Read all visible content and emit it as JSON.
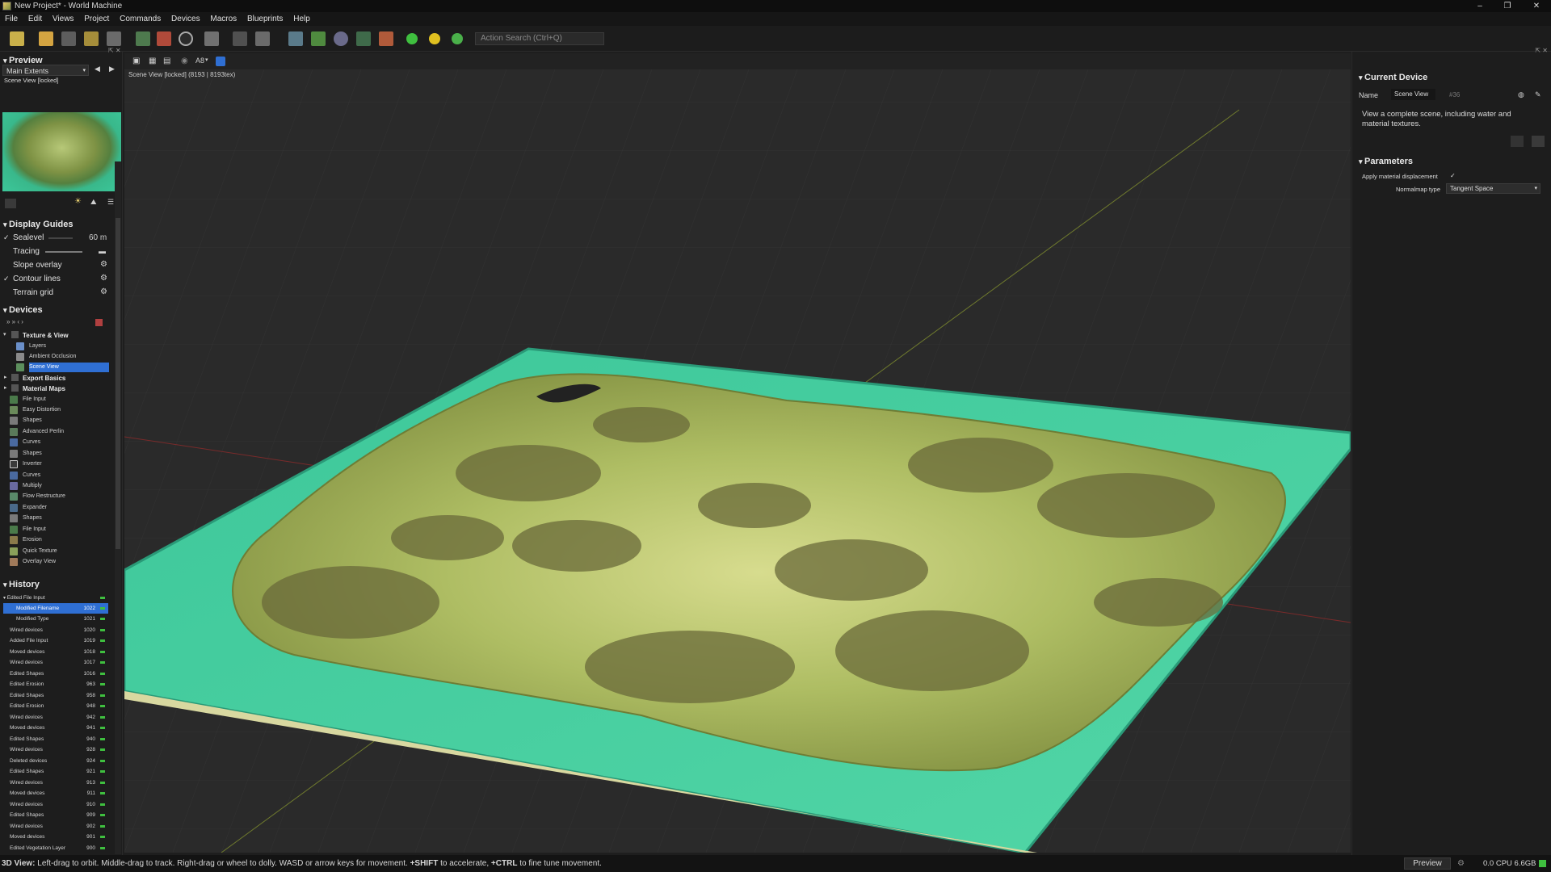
{
  "window": {
    "title": "New Project* - World Machine",
    "minimize": "–",
    "restore": "❐",
    "close": "✕"
  },
  "menu": [
    "File",
    "Edit",
    "Views",
    "Project",
    "Commands",
    "Devices",
    "Macros",
    "Blueprints",
    "Help"
  ],
  "toolbar": {
    "search_placeholder": "Action Search (Ctrl+Q)"
  },
  "preview": {
    "heading": "Preview",
    "extents": "Main Extents",
    "locked_label": "Scene View [locked]"
  },
  "guides": {
    "heading": "Display Guides",
    "items": [
      {
        "label": "Sealevel",
        "checked": "✓",
        "value": "60 m"
      },
      {
        "label": "Tracing",
        "checked": "",
        "value": ""
      },
      {
        "label": "Slope overlay",
        "checked": "",
        "value": ""
      },
      {
        "label": "Contour lines",
        "checked": "✓",
        "value": ""
      },
      {
        "label": "Terrain grid",
        "checked": "",
        "value": ""
      }
    ]
  },
  "devices": {
    "heading": "Devices",
    "groups": {
      "texture_view": "Texture & View",
      "export_basics": "Export Basics",
      "material_maps": "Material Maps"
    },
    "texture_items": [
      "Layers",
      "Ambient Occlusion",
      "Scene View"
    ],
    "items": [
      "File Input",
      "Easy Distortion",
      "Shapes",
      "Advanced Perlin",
      "Curves",
      "Shapes",
      "Inverter",
      "Curves",
      "Multiply",
      "Flow Restructure",
      "Expander",
      "Shapes",
      "File Input",
      "Erosion",
      "Quick Texture",
      "Overlay View"
    ]
  },
  "history": {
    "heading": "History",
    "items": [
      {
        "label": "Edited File Input",
        "n": ""
      },
      {
        "label": "Modified Filename",
        "n": "1022"
      },
      {
        "label": "Modified Type",
        "n": "1021"
      },
      {
        "label": "Wired devices",
        "n": "1020"
      },
      {
        "label": "Added File Input",
        "n": "1019"
      },
      {
        "label": "Moved devices",
        "n": "1018"
      },
      {
        "label": "Wired devices",
        "n": "1017"
      },
      {
        "label": "Edited Shapes",
        "n": "1016"
      },
      {
        "label": "Edited Erosion",
        "n": "963"
      },
      {
        "label": "Edited Shapes",
        "n": "958"
      },
      {
        "label": "Edited Erosion",
        "n": "948"
      },
      {
        "label": "Wired devices",
        "n": "942"
      },
      {
        "label": "Moved devices",
        "n": "941"
      },
      {
        "label": "Edited Shapes",
        "n": "940"
      },
      {
        "label": "Wired devices",
        "n": "928"
      },
      {
        "label": "Deleted devices",
        "n": "924"
      },
      {
        "label": "Edited Shapes",
        "n": "921"
      },
      {
        "label": "Wired devices",
        "n": "913"
      },
      {
        "label": "Moved devices",
        "n": "911"
      },
      {
        "label": "Wired devices",
        "n": "910"
      },
      {
        "label": "Edited Shapes",
        "n": "909"
      },
      {
        "label": "Wired devices",
        "n": "902"
      },
      {
        "label": "Moved devices",
        "n": "901"
      },
      {
        "label": "Edited Vegetation Layer",
        "n": "900"
      }
    ]
  },
  "viewport": {
    "aa_label": "A8",
    "info": "Scene View [locked] (8193 | 8193tex)"
  },
  "current_device": {
    "heading": "Current Device",
    "name_label": "Name",
    "name_value": "Scene View",
    "id": "#36",
    "description": "View a complete scene, including water and material textures."
  },
  "parameters": {
    "heading": "Parameters",
    "displacement_label": "Apply material displacement",
    "displacement_check": "✓",
    "normalmap_label": "Normalmap type",
    "normalmap_value": "Tangent Space"
  },
  "status": {
    "mode": "3D View:",
    "hint": "Left-drag to orbit. Middle-drag to track. Right-drag or wheel to dolly. WASD or arrow keys for movement.",
    "shift_key": "+SHIFT",
    "shift_text": "to accelerate,",
    "ctrl_key": "+CTRL",
    "ctrl_text": "to fine tune movement.",
    "preview_button": "Preview",
    "stats": "0.0 CPU 6.6GB"
  }
}
